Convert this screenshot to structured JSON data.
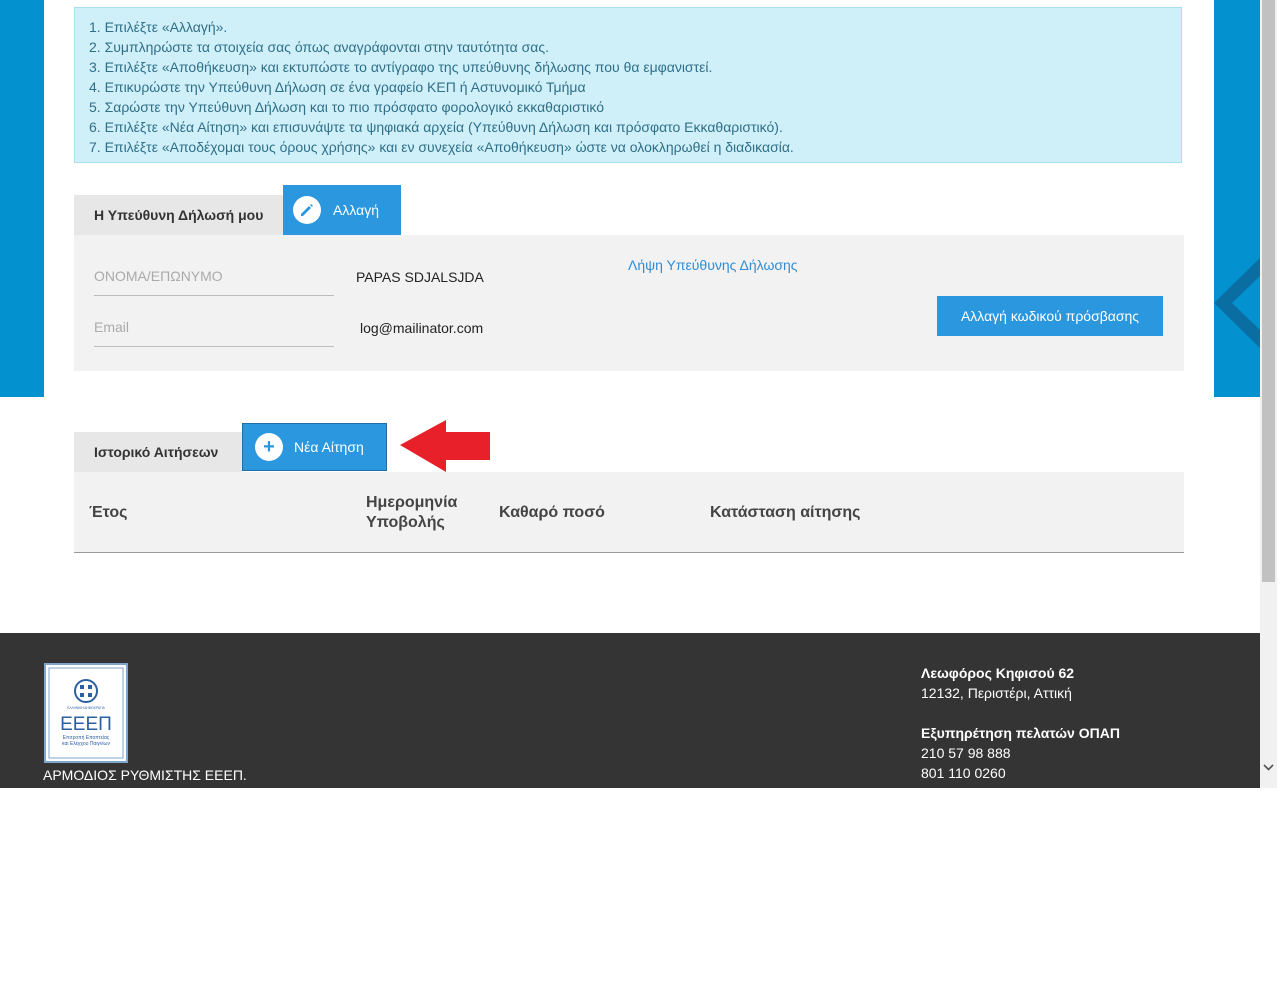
{
  "instructions": [
    "1. Επιλέξτε «Αλλαγή».",
    "2. Συμπληρώστε τα στοιχεία σας όπως αναγράφονται στην ταυτότητα σας.",
    "3. Επιλέξτε «Αποθήκευση» και εκτυπώστε το αντίγραφο της υπεύθυνης δήλωσης που θα εμφανιστεί.",
    "4. Επικυρώστε την Υπεύθυνη Δήλωση σε ένα γραφείο ΚΕΠ ή Αστυνομικό Τμήμα",
    "5. Σαρώστε την Υπεύθυνη Δήλωση και το πιο πρόσφατο φορολογικό εκκαθαριστικό",
    "6. Επιλέξτε «Νέα Αίτηση» και επισυνάψτε τα ψηφιακά αρχεία (Υπεύθυνη Δήλωση και πρόσφατο Εκκαθαριστικό).",
    "7. Επιλέξτε «Αποδέχομαι τους όρους χρήσης» και εν συνεχεία «Αποθήκευση» ώστε να ολοκληρωθεί η διαδικασία."
  ],
  "declaration": {
    "tab_label": "Η Υπεύθυνη Δήλωσή μου",
    "change_button": "Αλλαγή",
    "name_label": "ΟΝΟΜΑ/ΕΠΩΝΥΜΟ",
    "name_value": "PAPAS SDJALSJDA",
    "email_label": "Email",
    "email_value": "log@mailinator.com",
    "download_link": "Λήψη Υπεύθυνης Δήλωσης",
    "change_password_button": "Αλλαγή κωδικού πρόσβασης"
  },
  "history": {
    "tab_label": "Ιστορικό Αιτήσεων",
    "new_request_button": "Νέα Αίτηση",
    "columns": [
      "Έτος",
      "Ημερομηνία",
      "Υποβολής",
      "Καθαρό ποσό",
      "Κατάσταση αίτησης"
    ]
  },
  "footer": {
    "regulator": "ΑΡΜΟΔΙΟΣ ΡΥΘΜΙΣΤΗΣ ΕΕΕΠ.",
    "logo_text": "ΕΕΕΠ",
    "logo_top": "ΕΛΛΗΝΙΚΗ ΔΗΜΟΚΡΑΤΙΑ",
    "logo_sub1": "Επιτροπή Εποπτείας",
    "logo_sub2": "και Ελέγχου Παιγνίων",
    "address_title": "Λεωφόρος Κηφισού 62",
    "address_line": "12132, Περιστέρι, Αττική",
    "service_title": "Εξυπηρέτηση πελατών ΟΠΑΠ",
    "phone1": "210 57 98 888",
    "phone2": "801 110 0260"
  },
  "icons": {
    "edit": "pencil-icon",
    "add": "plus-icon",
    "annotation": "red-arrow-icon",
    "scroll_down": "chevron-down-icon"
  },
  "colors": {
    "brand_blue": "#0391d0",
    "button_blue": "#2b97de",
    "info_bg": "#d0f0f9",
    "footer_bg": "#343434",
    "annotation_red": "#e8202a"
  }
}
